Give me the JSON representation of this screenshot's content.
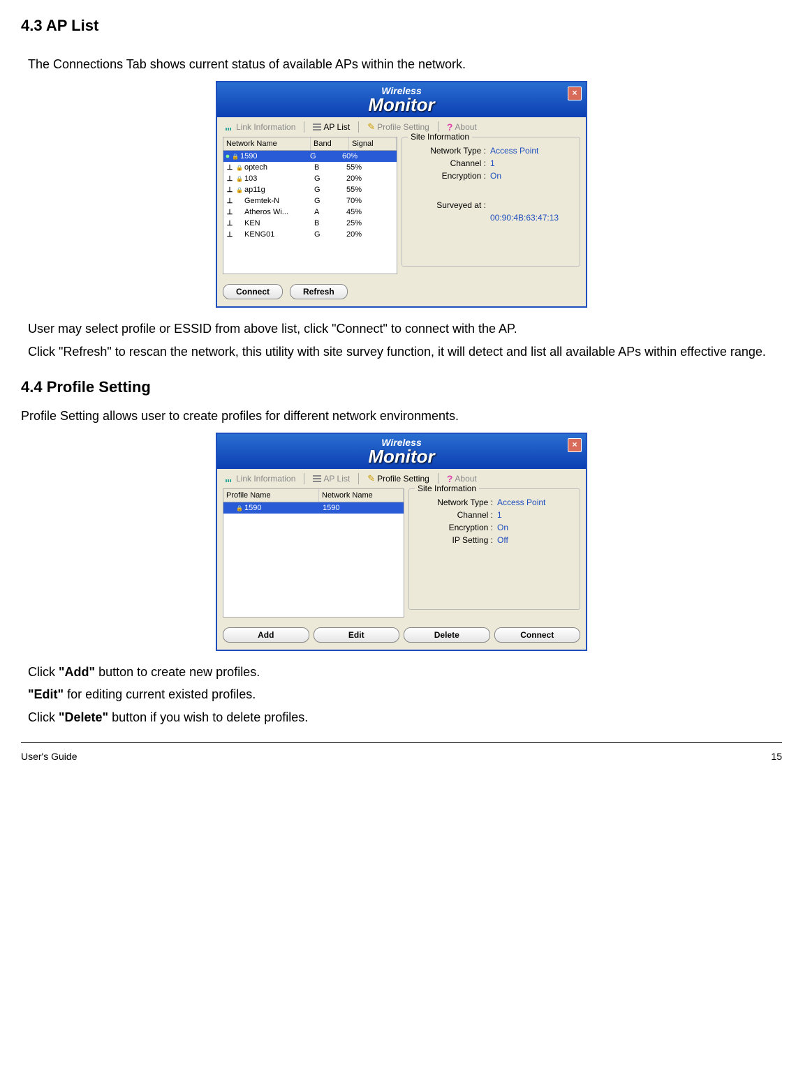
{
  "section43": {
    "heading": "4.3 AP List",
    "intro": "The Connections Tab shows current status of available APs within the network.",
    "after1": "User may select profile or ESSID from above list, click \"Connect\" to connect with the AP.",
    "after2": "Click \"Refresh\" to rescan the network, this utility with site survey function, it will detect and list all available APs within effective range."
  },
  "section44": {
    "heading": "4.4 Profile Setting",
    "intro": "Profile Setting allows user to create profiles for different network environments.",
    "after_add_pre": "Click ",
    "after_add_bold": "\"Add\"",
    "after_add_post": " button to create new profiles.",
    "after_edit_bold": "\"Edit\"",
    "after_edit_post": " for editing current existed profiles.",
    "after_delete_pre": "Click ",
    "after_delete_bold": "\"Delete\"",
    "after_delete_post": " button if you wish to delete profiles."
  },
  "app": {
    "logo1": "Wireless",
    "logo2": "Monitor",
    "tabs": {
      "link_info": "Link Information",
      "ap_list": "AP List",
      "profile_setting": "Profile Setting",
      "about": "About"
    },
    "aplist": {
      "columns": {
        "name": "Network Name",
        "band": "Band",
        "signal": "Signal"
      },
      "rows": [
        {
          "name": "1590",
          "band": "G",
          "signal": "60%",
          "locked": true,
          "selected": true
        },
        {
          "name": "optech",
          "band": "B",
          "signal": "55%",
          "locked": true
        },
        {
          "name": "103",
          "band": "G",
          "signal": "20%",
          "locked": true
        },
        {
          "name": "ap11g",
          "band": "G",
          "signal": "55%",
          "locked": true
        },
        {
          "name": "Gemtek-N",
          "band": "G",
          "signal": "70%",
          "locked": false
        },
        {
          "name": "Atheros Wi...",
          "band": "A",
          "signal": "45%",
          "locked": false
        },
        {
          "name": "KEN",
          "band": "B",
          "signal": "25%",
          "locked": false
        },
        {
          "name": "KENG01",
          "band": "G",
          "signal": "20%",
          "locked": false
        }
      ],
      "site": {
        "legend": "Site Information",
        "network_type_label": "Network Type :",
        "network_type_value": "Access Point",
        "channel_label": "Channel :",
        "channel_value": "1",
        "encryption_label": "Encryption :",
        "encryption_value": "On",
        "surveyed_label": "Surveyed at :",
        "surveyed_value": "00:90:4B:63:47:13"
      },
      "buttons": {
        "connect": "Connect",
        "refresh": "Refresh"
      }
    },
    "profile": {
      "columns": {
        "profile": "Profile Name",
        "network": "Network Name"
      },
      "rows": [
        {
          "profile": "1590",
          "network": "1590",
          "locked": true,
          "selected": true
        }
      ],
      "site": {
        "legend": "Site Information",
        "network_type_label": "Network Type :",
        "network_type_value": "Access Point",
        "channel_label": "Channel :",
        "channel_value": "1",
        "encryption_label": "Encryption :",
        "encryption_value": "On",
        "ip_label": "IP Setting :",
        "ip_value": "Off"
      },
      "buttons": {
        "add": "Add",
        "edit": "Edit",
        "delete": "Delete",
        "connect": "Connect"
      }
    }
  },
  "footer": {
    "guide": "User's Guide",
    "page": "15"
  }
}
